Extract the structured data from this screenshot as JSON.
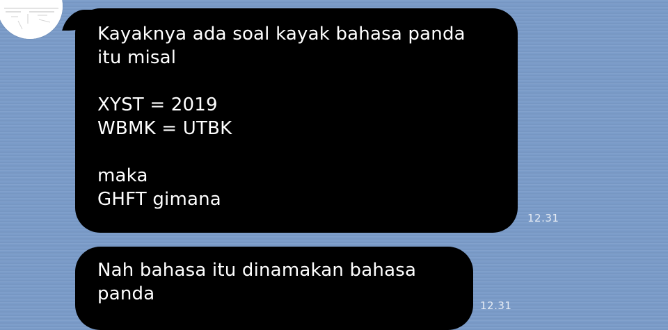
{
  "chat": {
    "messages": [
      {
        "lines": [
          "Kayaknya ada soal kayak bahasa panda",
          "itu misal",
          "",
          "XYST = 2019",
          "WBMK = UTBK",
          "",
          "maka",
          "GHFT gimana"
        ],
        "time": "12.31"
      },
      {
        "lines": [
          "Nah bahasa itu dinamakan bahasa",
          "panda"
        ],
        "time": "12.31"
      }
    ]
  },
  "colors": {
    "background": "#7b9cc9",
    "bubble": "#000000",
    "bubble_text": "#ffffff",
    "avatar_bg": "#ffffff"
  }
}
